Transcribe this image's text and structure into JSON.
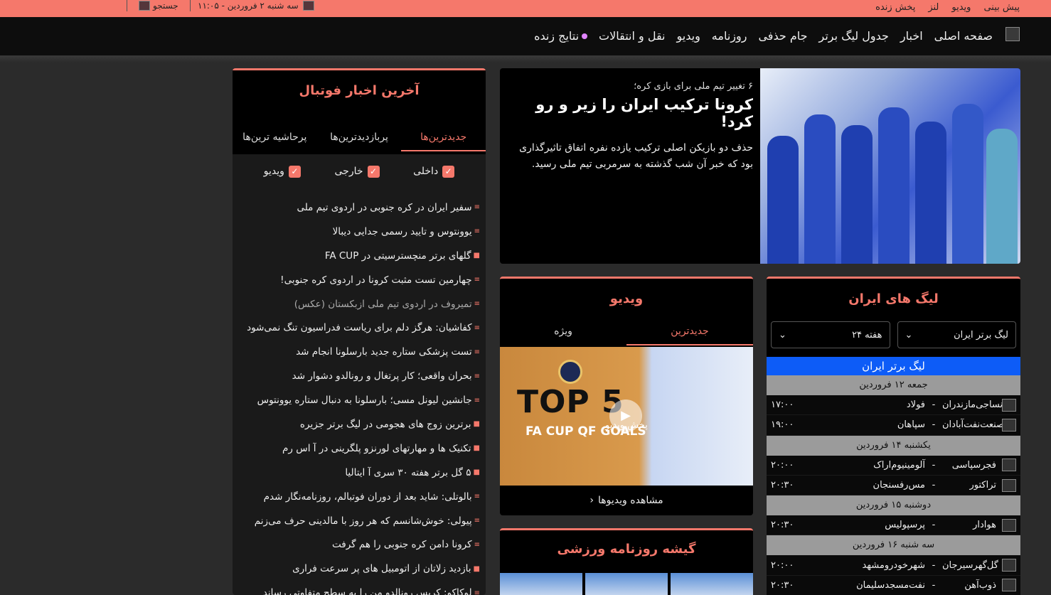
{
  "topbar": {
    "links": [
      "پیش بینی",
      "ویدیو",
      "لنز",
      "پخش زنده"
    ],
    "date": "سه شنبه ۲ فروردین - ۱۱:۰۵",
    "search": "جستجو"
  },
  "nav": {
    "items": [
      "صفحه اصلی",
      "اخبار",
      "جدول لیگ برتر",
      "جام حذفی",
      "روزنامه",
      "ویدیو",
      "نقل و انتقالات",
      "نتایج زنده"
    ]
  },
  "hero": {
    "kicker": "۶ تغییر تیم ملی برای بازی کره؛",
    "title": "کرونا ترکیب ایران را زیر و رو کرد!",
    "summary": "حذف دو بازیکن اصلی ترکیب یازده نفره اتفاق تاثیرگذاری بود که خبر آن شب گذشته به سرمربی تیم ملی رسید."
  },
  "news": {
    "title": "آخرین اخبار فوتبال",
    "tabs": [
      "جدیدترین‌ها",
      "پربازدیدترین‌ها",
      "پرحاشیه ترین‌ها"
    ],
    "filters": [
      "داخلی",
      "خارجی",
      "ویدیو"
    ],
    "items": [
      "سفیر ایران در کره جنوبی در اردوی تیم ملی",
      "یوونتوس و تایید رسمی جدایی دیبالا",
      "گلهای برتر منچسترسیتی در FA CUP",
      "چهارمین تست مثبت کرونا در اردوی کره جنوبی!",
      "تمیروف در اردوی تیم ملی ازبکستان (عکس)",
      "کفاشیان: هرگز دلم برای ریاست فدراسیون تنگ نمی‌شود",
      "تست پزشکی ستاره جدید بارسلونا انجام شد",
      "بحران واقعی؛ کار پرتغال و رونالدو دشوار شد",
      "جانشین لیونل مسی؛ بارسلونا به دنبال ستاره یوونتوس",
      "برترین زوج های هجومی در لیگ برتر جزیره",
      "تکنیک ها و مهارتهای لورنزو پلگرینی در آ اس رم",
      "۵ گل برتر هفته ۳۰ سری آ ایتالیا",
      "بالوتلی: شاید بعد از دوران فوتبالم، روزنامه‌نگار شدم",
      "پیولی: خوش‌شانسم که هر روز با مالدینی حرف می‌زنم",
      "کرونا دامن کره جنوبی را هم گرفت",
      "بازدید زلاتان از اتومبیل های پر سرعت فراری",
      "لوکاکو: کریس رونالدو من را به سطح متفاوتی رساند"
    ],
    "item_icons": [
      "doc",
      "doc",
      "video",
      "doc",
      "doc",
      "doc",
      "doc",
      "doc",
      "doc",
      "video",
      "video",
      "video",
      "doc",
      "doc",
      "doc",
      "video",
      "doc"
    ]
  },
  "video": {
    "title": "ویدیو",
    "tabs": [
      "جدیدترین",
      "ویژه"
    ],
    "thumb_title": "TOP 5",
    "thumb_sub": "FA CUP QF GOALS",
    "play_label": "پخش ویدیو",
    "more": "مشاهده ویدیوها"
  },
  "kiosk": {
    "title": "گیشه روزنامه ورزشی"
  },
  "league": {
    "title": "لیگ های ایران",
    "select_league": "لیگ برتر ایران",
    "select_week": "هفته ۲۴",
    "header": "لیگ برتر ایران",
    "days": [
      {
        "label": "جمعه ۱۲ فروردین",
        "matches": [
          {
            "home": "نساجی‌مازندران",
            "away": "فولاد",
            "time": "۱۷:۰۰"
          },
          {
            "home": "صنعت‌نفت‌آبادان",
            "away": "سپاهان",
            "time": "۱۹:۰۰"
          }
        ]
      },
      {
        "label": "یکشنبه ۱۴ فروردین",
        "matches": [
          {
            "home": "فجرسپاسی",
            "away": "آلومینیوم‌اراک",
            "time": "۲۰:۰۰"
          },
          {
            "home": "تراکتور",
            "away": "مس‌رفسنجان",
            "time": "۲۰:۳۰"
          }
        ]
      },
      {
        "label": "دوشنبه ۱۵ فروردین",
        "matches": [
          {
            "home": "هوادار",
            "away": "پرسپولیس",
            "time": "۲۰:۳۰"
          }
        ]
      },
      {
        "label": "سه شنبه ۱۶ فروردین",
        "matches": [
          {
            "home": "گل‌گهرسیرجان",
            "away": "شهرخودرومشهد",
            "time": "۲۰:۰۰"
          },
          {
            "home": "ذوب‌آهن",
            "away": "نفت‌مسجدسلیمان",
            "time": "۲۰:۳۰"
          }
        ]
      }
    ]
  },
  "colors": {
    "accent": "#f5786b",
    "league_header": "#0d5cf7",
    "day_row": "#9b9b9b"
  }
}
